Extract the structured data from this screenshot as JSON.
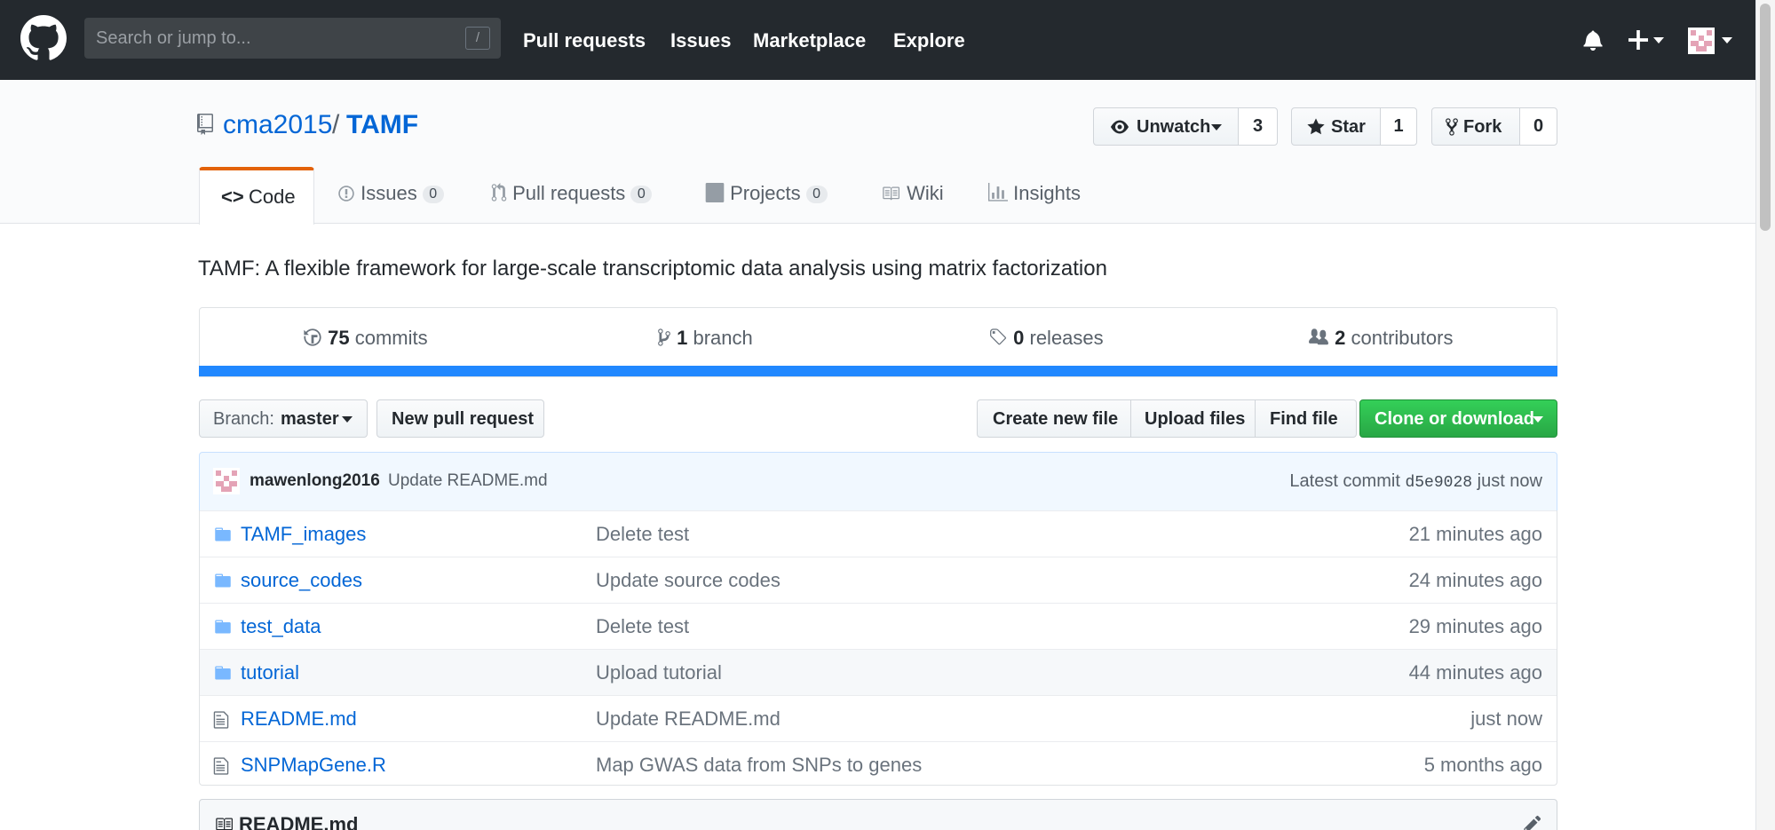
{
  "header": {
    "search_placeholder": "Search or jump to...",
    "search_shortcut": "/",
    "nav": [
      "Pull requests",
      "Issues",
      "Marketplace",
      "Explore"
    ]
  },
  "repo": {
    "owner": "cma2015",
    "separator": "/",
    "name": "TAMF",
    "unwatch_label": "Unwatch",
    "watch_count": "3",
    "star_label": "Star",
    "star_count": "1",
    "fork_label": "Fork",
    "fork_count": "0"
  },
  "tabs": [
    {
      "label": "Code"
    },
    {
      "label": "Issues",
      "count": "0"
    },
    {
      "label": "Pull requests",
      "count": "0"
    },
    {
      "label": "Projects",
      "count": "0"
    },
    {
      "label": "Wiki"
    },
    {
      "label": "Insights"
    }
  ],
  "description": "TAMF: A flexible framework for large-scale transcriptomic data analysis using matrix factorization",
  "summary": {
    "commits_num": "75",
    "commits_label": "commits",
    "branch_num": "1",
    "branch_label": "branch",
    "releases_num": "0",
    "releases_label": "releases",
    "contributors_num": "2",
    "contributors_label": "contributors"
  },
  "file_nav": {
    "branch_prefix": "Branch:",
    "branch_name": "master",
    "new_pr": "New pull request",
    "create_file": "Create new file",
    "upload_files": "Upload files",
    "find_file": "Find file",
    "clone": "Clone or download"
  },
  "latest_commit": {
    "author": "mawenlong2016",
    "message": "Update README.md",
    "prefix": "Latest commit",
    "sha": "d5e9028",
    "age": "just now"
  },
  "files": [
    {
      "name": "TAMF_images",
      "type": "folder",
      "message": "Delete test",
      "age": "21 minutes ago"
    },
    {
      "name": "source_codes",
      "type": "folder",
      "message": "Update source codes",
      "age": "24 minutes ago"
    },
    {
      "name": "test_data",
      "type": "folder",
      "message": "Delete test",
      "age": "29 minutes ago"
    },
    {
      "name": "tutorial",
      "type": "folder",
      "message": "Upload tutorial",
      "age": "44 minutes ago"
    },
    {
      "name": "README.md",
      "type": "file",
      "message": "Update README.md",
      "age": "just now"
    },
    {
      "name": "SNPMapGene.R",
      "type": "file",
      "message": "Map GWAS data from SNPs to genes",
      "age": "5 months ago"
    }
  ],
  "readme_title": "README.md",
  "colors": {
    "header_bg": "#24292e",
    "link": "#0366d6",
    "clone_green": "#28a745",
    "progress_blue": "#2188ff",
    "active_tab": "#e36209"
  }
}
